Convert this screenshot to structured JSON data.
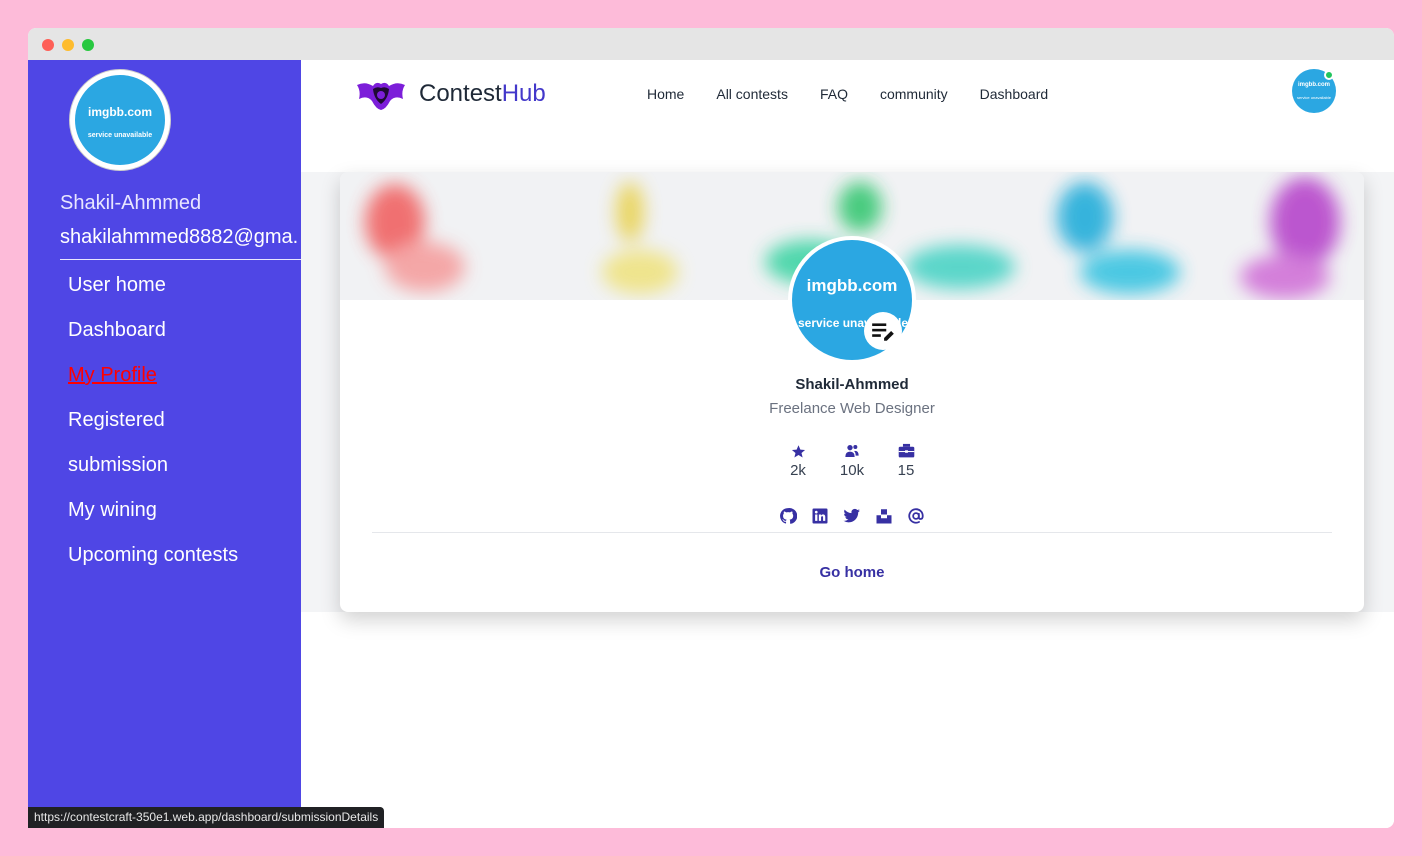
{
  "sidebar": {
    "avatar": {
      "line1": "imgbb.com",
      "line2": "service unavailable"
    },
    "user_name": "Shakil-Ahmmed",
    "user_email": "shakilahmmed8882@gma..",
    "items": [
      {
        "label": "User home"
      },
      {
        "label": "Dashboard"
      },
      {
        "label": "My Profile"
      },
      {
        "label": "Registered"
      },
      {
        "label": "submission"
      },
      {
        "label": "My wining"
      },
      {
        "label": "Upcoming contests"
      }
    ],
    "active_color": "#ff0000"
  },
  "header": {
    "brand_part1": "Contest",
    "brand_part2": "Hub",
    "nav": [
      {
        "label": "Home"
      },
      {
        "label": "All contests"
      },
      {
        "label": "FAQ"
      },
      {
        "label": "community"
      },
      {
        "label": "Dashboard"
      }
    ],
    "avatar": {
      "line1": "imgbb.com",
      "line2": "service unavailable"
    }
  },
  "profile": {
    "avatar": {
      "line1": "imgbb.com",
      "line2": "service unavailable"
    },
    "name": "Shakil-Ahmmed",
    "title": "Freelance Web Designer",
    "stats": [
      {
        "icon": "star-icon",
        "value": "2k"
      },
      {
        "icon": "users-icon",
        "value": "10k"
      },
      {
        "icon": "briefcase-icon",
        "value": "15"
      }
    ],
    "socials": [
      "github-icon",
      "linkedin-icon",
      "twitter-icon",
      "unsplash-icon",
      "at-icon"
    ],
    "go_home": "Go home"
  },
  "status_bar": {
    "url": "https://contestcraft-350e1.web.app/dashboard/submissionDetails"
  },
  "colors": {
    "sidebar": "#4f46e5",
    "accent": "#4338ca",
    "icons": "#3730a3",
    "avatar_blue": "#2ba7e2",
    "online": "#22c55e"
  }
}
